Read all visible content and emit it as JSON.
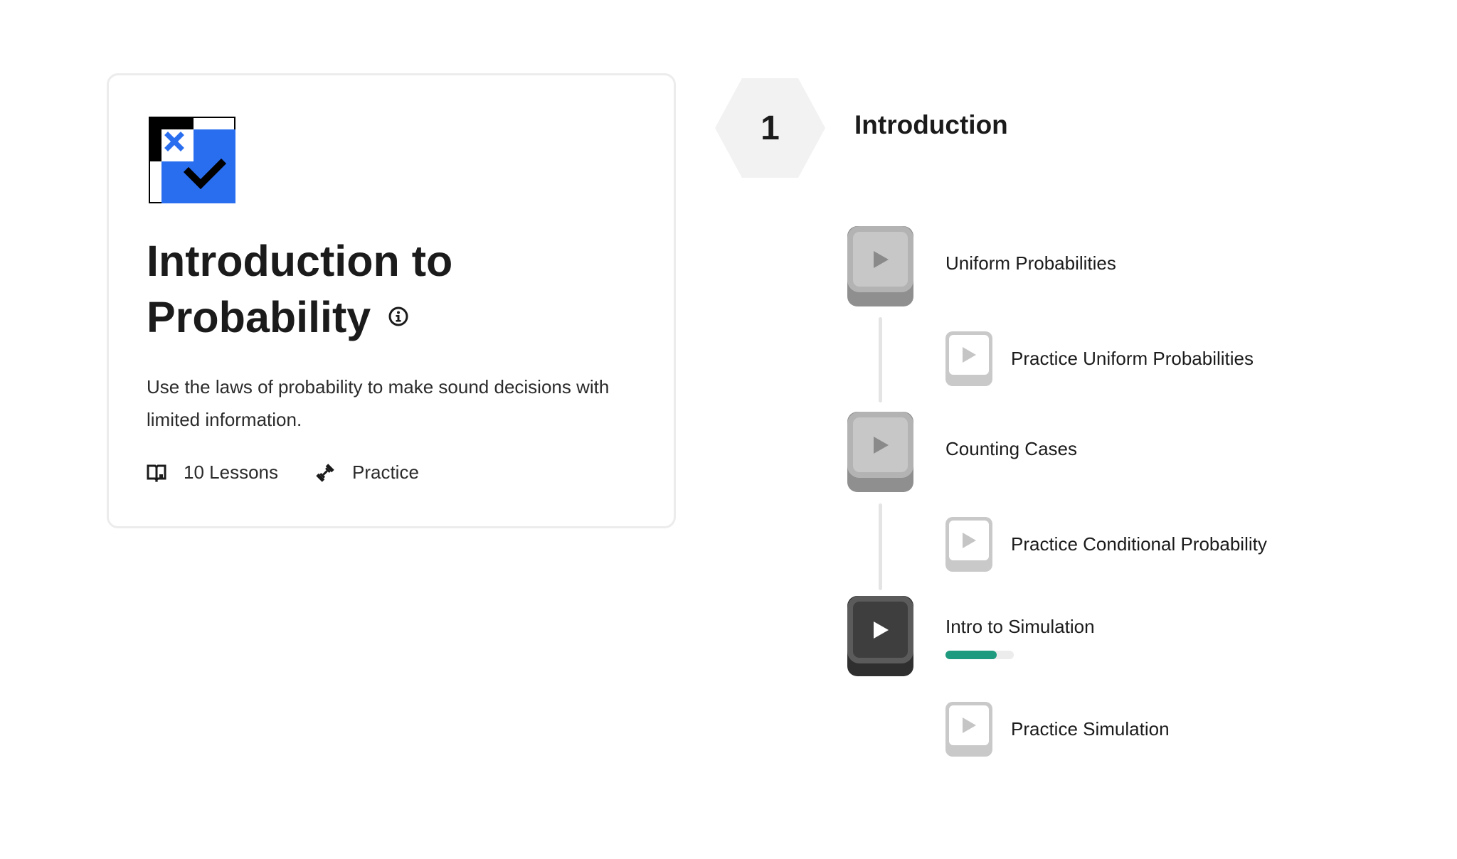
{
  "course": {
    "title_line1": "Introduction to",
    "title_line2": "Probability",
    "description": "Use the laws of probability to make sound decisions with limited information.",
    "lessons_count": "10 Lessons",
    "practice_label": "Practice",
    "logo_icon": "course-logo-check-x",
    "info_icon": "info-icon"
  },
  "chapter": {
    "number": "1",
    "title": "Introduction"
  },
  "lessons": [
    {
      "label": "Uniform Probabilities",
      "kind": "lesson",
      "state": "not-started"
    },
    {
      "label": "Practice Uniform Probabilities",
      "kind": "practice",
      "state": "not-started"
    },
    {
      "label": "Counting Cases",
      "kind": "lesson",
      "state": "not-started"
    },
    {
      "label": "Practice Conditional Probability",
      "kind": "practice",
      "state": "not-started"
    },
    {
      "label": "Intro to Simulation",
      "kind": "lesson",
      "state": "in-progress",
      "progress": 0.75
    },
    {
      "label": "Practice Simulation",
      "kind": "practice",
      "state": "not-started"
    }
  ],
  "colors": {
    "logo_blue": "#2a6ef0",
    "progress_green": "#1e9b7f",
    "hex_bg": "#f2f2f2"
  }
}
